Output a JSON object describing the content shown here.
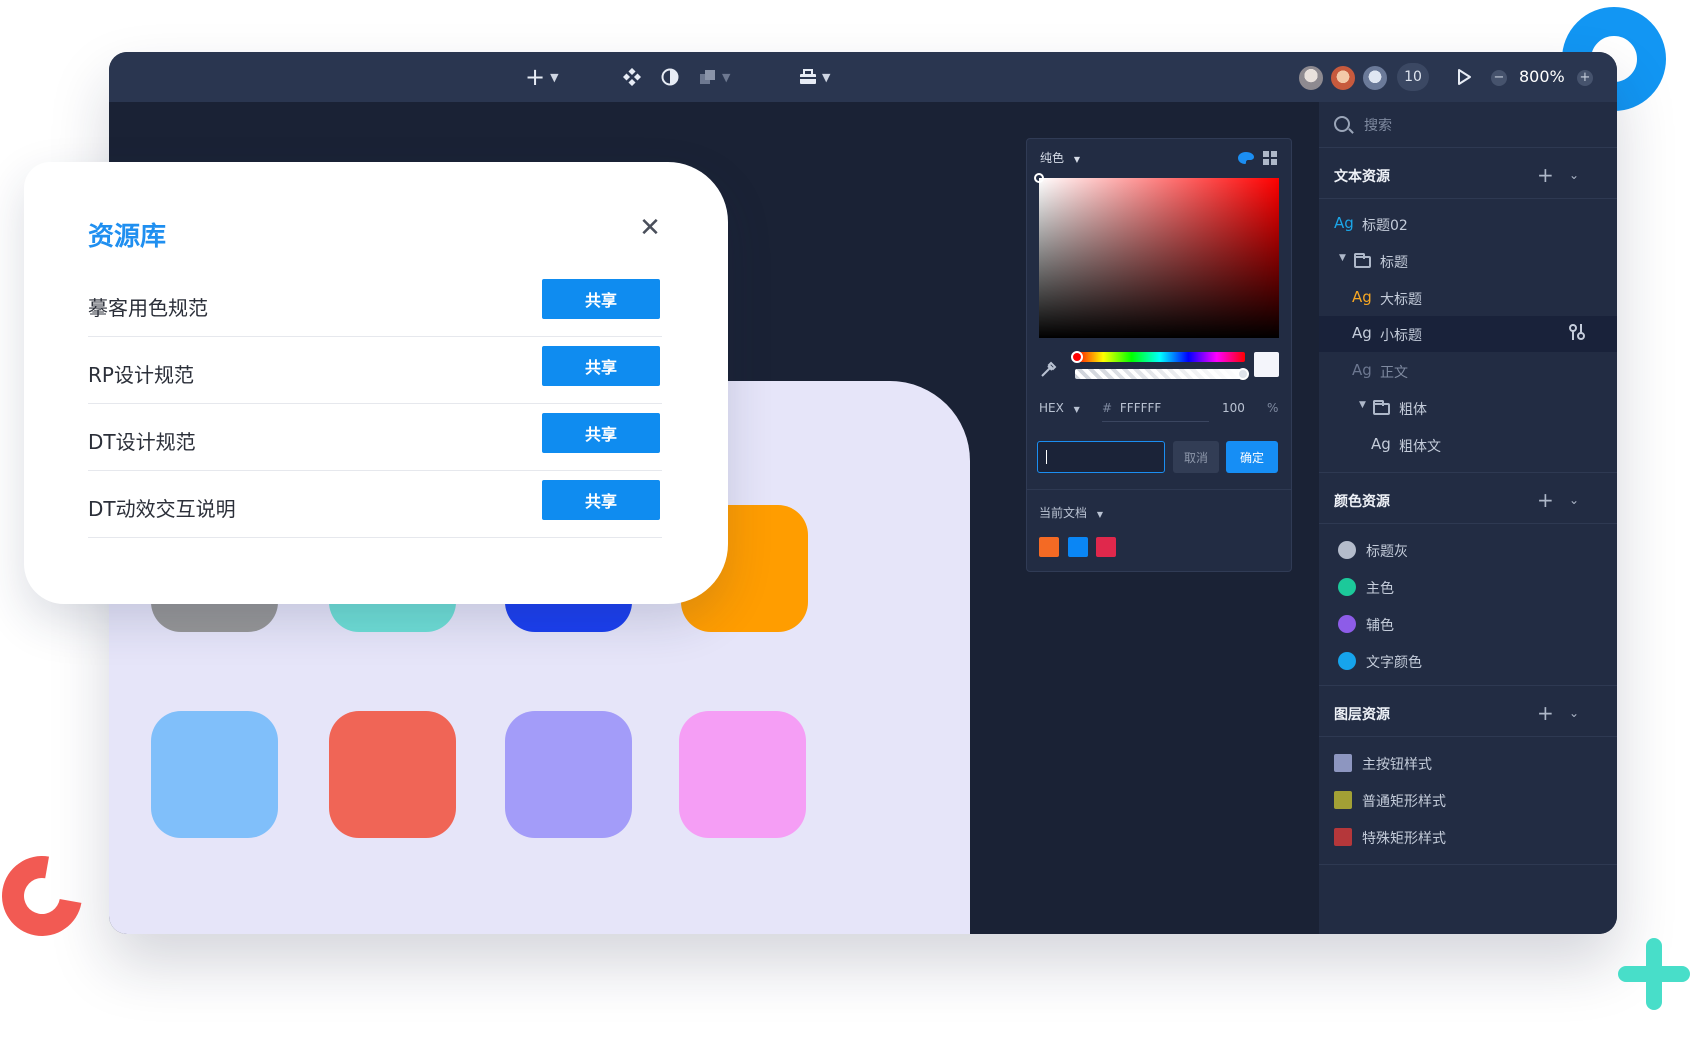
{
  "toolbar": {
    "add_icon": "plus-icon",
    "component_icon": "component-icon",
    "contrast_icon": "contrast-icon",
    "layers_icon": "stack-icon",
    "toolbox_icon": "toolbox-icon",
    "user_count": "10",
    "zoom": "800%",
    "zoom_out": "−",
    "zoom_in": "+"
  },
  "canvas": {
    "tiles": [
      {
        "color": "#979797"
      },
      {
        "color": "#6edfd6"
      },
      {
        "color": "#1b3ff0"
      },
      {
        "color": "#ff9d00"
      },
      {
        "color": "#80bffa"
      },
      {
        "color": "#f06556"
      },
      {
        "color": "#a39cf9"
      },
      {
        "color": "#f59ef5"
      }
    ]
  },
  "color_picker": {
    "type_label": "纯色",
    "format": "HEX",
    "hex_prefix": "#",
    "hex_value": "FFFFFF",
    "alpha": "100",
    "alpha_unit": "%",
    "input_value": "",
    "cancel_label": "取消",
    "ok_label": "确定",
    "doc_label": "当前文档",
    "swatches": [
      "#f46a24",
      "#0a86f5",
      "#e0284c"
    ]
  },
  "sidebar": {
    "search_placeholder": "搜索",
    "text_section": {
      "title": "文本资源",
      "items": [
        {
          "ag": "Ag",
          "label": "标题02",
          "ag_color": "#1ba6e8"
        },
        {
          "label": "标题"
        },
        {
          "ag": "Ag",
          "label": "大标题",
          "ag_color": "#f5a623"
        },
        {
          "ag": "Ag",
          "label": "小标题",
          "ag_color": "#c4ccda"
        },
        {
          "ag": "Ag",
          "label": "正文",
          "ag_color": "#6c7790"
        },
        {
          "label": "粗体"
        },
        {
          "ag": "Ag",
          "label": "粗体文",
          "ag_color": "#c4ccda"
        }
      ]
    },
    "color_section": {
      "title": "颜色资源",
      "items": [
        {
          "label": "标题灰",
          "color": "#b4bccb"
        },
        {
          "label": "主色",
          "color": "#1cc99a"
        },
        {
          "label": "辅色",
          "color": "#8d5ce8"
        },
        {
          "label": "文字颜色",
          "color": "#16a4ec"
        }
      ]
    },
    "layer_section": {
      "title": "图层资源",
      "items": [
        {
          "label": "主按钮样式",
          "color": "#8d96c0"
        },
        {
          "label": "普通矩形样式",
          "color": "#a2a035"
        },
        {
          "label": "特殊矩形样式",
          "color": "#b5373a"
        }
      ]
    }
  },
  "library": {
    "title": "资源库",
    "close": "✕",
    "share_label": "共享",
    "items": [
      {
        "name": "摹客用色规范"
      },
      {
        "name": "RP设计规范"
      },
      {
        "name": "DT设计规范"
      },
      {
        "name": "DT动效交互说明"
      }
    ]
  }
}
